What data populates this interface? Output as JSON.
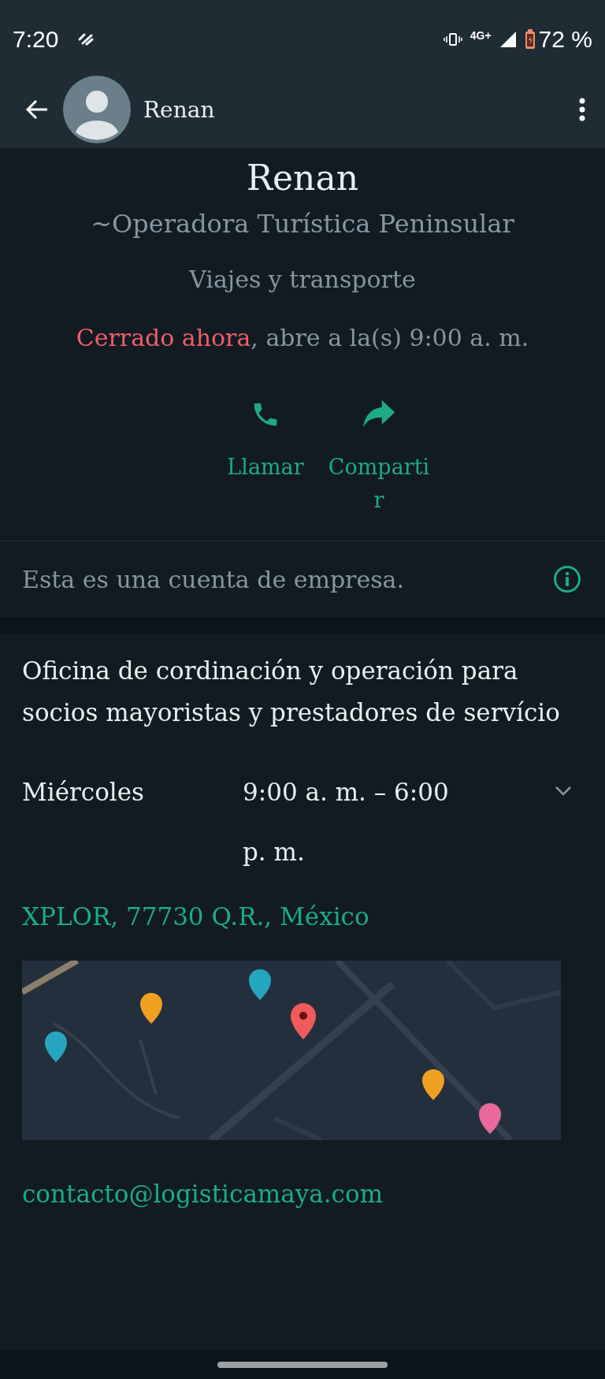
{
  "status_bar": {
    "time": "7:20",
    "network": "4G+",
    "battery": "72 %"
  },
  "app_bar": {
    "title": "Renan"
  },
  "profile": {
    "name": "Renan",
    "push_name": "~Operadora Turística Peninsular",
    "category": "Viajes y transporte",
    "status": {
      "open": false,
      "state": "Cerrado ahora",
      "detail": ", abre a la(s) 9:00 a. m."
    }
  },
  "actions": [
    {
      "kind": "call",
      "label": "Llamar"
    },
    {
      "kind": "share",
      "label": "Compartir"
    }
  ],
  "business_notice": "Esta es una cuenta de empresa.",
  "description": "Oficina de cordinación y operación para socios mayoristas y prestadores de servício",
  "hours": {
    "day": "Miércoles",
    "time": "9:00 a. m. – 6:00 p. m.",
    "expanded": false
  },
  "address": "XPLOR, 77730 Q.R., México",
  "email": "contacto@logisticamaya.com"
}
